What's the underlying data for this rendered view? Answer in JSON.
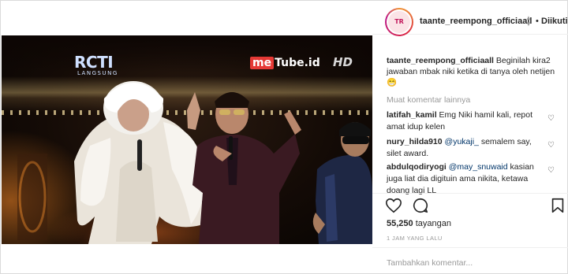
{
  "post": {
    "author": "taante_reempong_officiaall",
    "follow_label": "Diikuti",
    "dot_separator": "•",
    "avatar_text": "TR"
  },
  "media": {
    "logo_rcti": "RCTI",
    "logo_rcti_sub": "LANGSUNG",
    "logo_metube_prefix": "me",
    "logo_metube_suffix": "Tube.id",
    "logo_hd": "HD"
  },
  "caption": {
    "user": "taante_reempong_officiaall",
    "text": "Beginilah kira2 jawaban mbak niki ketika di tanya oleh netijen",
    "emoji": "😁"
  },
  "load_more_label": "Muat komentar lainnya",
  "comments": [
    {
      "user": "latifah_kamil",
      "mention": "",
      "text": "Emg Niki hamil kali, repot amat idup kelen"
    },
    {
      "user": "nury_hilda910",
      "mention": "@yukaji_",
      "text": "semalem say, silet award."
    },
    {
      "user": "abdulqodiryogi",
      "mention": "@may_snuwaid",
      "text": "kasian juga liat dia digituin ama nikita, ketawa doang lagi LL"
    }
  ],
  "stats": {
    "views_count": "55,250",
    "views_label": "tayangan",
    "time_ago": "1 JAM YANG LALU"
  },
  "add_comment_placeholder": "Tambahkan komentar...",
  "icons": {
    "heart": "heart-icon",
    "comment": "comment-icon",
    "bookmark": "bookmark-icon"
  },
  "colors": {
    "text": "#262626",
    "muted": "#999999",
    "mention": "#003569",
    "border": "#dbdbdb"
  }
}
